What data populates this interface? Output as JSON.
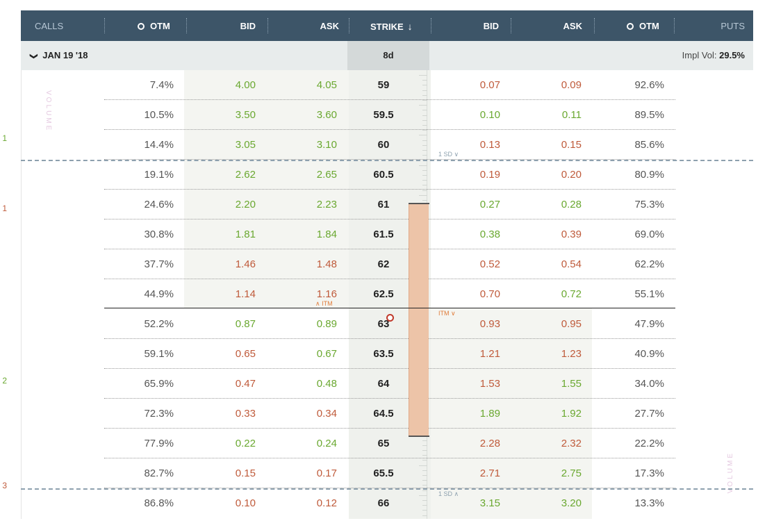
{
  "header": {
    "calls": "CALLS",
    "call_otm": "OTM",
    "call_bid": "BID",
    "call_ask": "ASK",
    "strike": "STRIKE",
    "strike_sort_icon": "↓",
    "put_bid": "BID",
    "put_ask": "ASK",
    "put_otm": "OTM",
    "puts": "PUTS"
  },
  "expiry": {
    "chevron": "❯",
    "label": "JAN 19 '18",
    "days": "8d",
    "impl_vol_label": "Impl Vol: ",
    "impl_vol_value": "29.5%"
  },
  "volume_label": "VOLUME",
  "gutter": [
    {
      "text": "1",
      "color": "#6aa830"
    },
    {
      "text": "1",
      "color": "#bf5a3a"
    },
    {
      "text": "2",
      "color": "#6aa830"
    },
    {
      "text": "3",
      "color": "#bf5a3a"
    }
  ],
  "sd_labels": {
    "upper": "1 SD ∨",
    "lower": "1 SD ∧"
  },
  "itm_labels": {
    "calls": "∧ ITM",
    "puts": "ITM ∨"
  },
  "colors": {
    "green": "#6aa830",
    "red": "#bf5a3a",
    "header_bg": "#3d5568",
    "expected_move": "#edc4a8"
  },
  "rows": [
    {
      "call_otm": "7.4%",
      "call_bid": "4.00",
      "call_bid_c": "green",
      "call_ask": "4.05",
      "call_ask_c": "green",
      "strike": "59",
      "put_bid": "0.07",
      "put_bid_c": "red",
      "put_ask": "0.09",
      "put_ask_c": "red",
      "put_otm": "92.6%"
    },
    {
      "call_otm": "10.5%",
      "call_bid": "3.50",
      "call_bid_c": "green",
      "call_ask": "3.60",
      "call_ask_c": "green",
      "strike": "59.5",
      "put_bid": "0.10",
      "put_bid_c": "green",
      "put_ask": "0.11",
      "put_ask_c": "green",
      "put_otm": "89.5%"
    },
    {
      "call_otm": "14.4%",
      "call_bid": "3.05",
      "call_bid_c": "green",
      "call_ask": "3.10",
      "call_ask_c": "green",
      "strike": "60",
      "put_bid": "0.13",
      "put_bid_c": "red",
      "put_ask": "0.15",
      "put_ask_c": "red",
      "put_otm": "85.6%"
    },
    {
      "call_otm": "19.1%",
      "call_bid": "2.62",
      "call_bid_c": "green",
      "call_ask": "2.65",
      "call_ask_c": "green",
      "strike": "60.5",
      "put_bid": "0.19",
      "put_bid_c": "red",
      "put_ask": "0.20",
      "put_ask_c": "red",
      "put_otm": "80.9%"
    },
    {
      "call_otm": "24.6%",
      "call_bid": "2.20",
      "call_bid_c": "green",
      "call_ask": "2.23",
      "call_ask_c": "green",
      "strike": "61",
      "put_bid": "0.27",
      "put_bid_c": "green",
      "put_ask": "0.28",
      "put_ask_c": "green",
      "put_otm": "75.3%"
    },
    {
      "call_otm": "30.8%",
      "call_bid": "1.81",
      "call_bid_c": "green",
      "call_ask": "1.84",
      "call_ask_c": "green",
      "strike": "61.5",
      "put_bid": "0.38",
      "put_bid_c": "green",
      "put_ask": "0.39",
      "put_ask_c": "red",
      "put_otm": "69.0%"
    },
    {
      "call_otm": "37.7%",
      "call_bid": "1.46",
      "call_bid_c": "red",
      "call_ask": "1.48",
      "call_ask_c": "red",
      "strike": "62",
      "put_bid": "0.52",
      "put_bid_c": "red",
      "put_ask": "0.54",
      "put_ask_c": "red",
      "put_otm": "62.2%"
    },
    {
      "call_otm": "44.9%",
      "call_bid": "1.14",
      "call_bid_c": "red",
      "call_ask": "1.16",
      "call_ask_c": "red",
      "strike": "62.5",
      "put_bid": "0.70",
      "put_bid_c": "red",
      "put_ask": "0.72",
      "put_ask_c": "green",
      "put_otm": "55.1%"
    },
    {
      "call_otm": "52.2%",
      "call_bid": "0.87",
      "call_bid_c": "green",
      "call_ask": "0.89",
      "call_ask_c": "green",
      "strike": "63",
      "put_bid": "0.93",
      "put_bid_c": "red",
      "put_ask": "0.95",
      "put_ask_c": "red",
      "put_otm": "47.9%"
    },
    {
      "call_otm": "59.1%",
      "call_bid": "0.65",
      "call_bid_c": "red",
      "call_ask": "0.67",
      "call_ask_c": "green",
      "strike": "63.5",
      "put_bid": "1.21",
      "put_bid_c": "red",
      "put_ask": "1.23",
      "put_ask_c": "red",
      "put_otm": "40.9%"
    },
    {
      "call_otm": "65.9%",
      "call_bid": "0.47",
      "call_bid_c": "red",
      "call_ask": "0.48",
      "call_ask_c": "green",
      "strike": "64",
      "put_bid": "1.53",
      "put_bid_c": "red",
      "put_ask": "1.55",
      "put_ask_c": "green",
      "put_otm": "34.0%"
    },
    {
      "call_otm": "72.3%",
      "call_bid": "0.33",
      "call_bid_c": "red",
      "call_ask": "0.34",
      "call_ask_c": "red",
      "strike": "64.5",
      "put_bid": "1.89",
      "put_bid_c": "green",
      "put_ask": "1.92",
      "put_ask_c": "green",
      "put_otm": "27.7%"
    },
    {
      "call_otm": "77.9%",
      "call_bid": "0.22",
      "call_bid_c": "green",
      "call_ask": "0.24",
      "call_ask_c": "green",
      "strike": "65",
      "put_bid": "2.28",
      "put_bid_c": "red",
      "put_ask": "2.32",
      "put_ask_c": "red",
      "put_otm": "22.2%"
    },
    {
      "call_otm": "82.7%",
      "call_bid": "0.15",
      "call_bid_c": "red",
      "call_ask": "0.17",
      "call_ask_c": "red",
      "strike": "65.5",
      "put_bid": "2.71",
      "put_bid_c": "red",
      "put_ask": "2.75",
      "put_ask_c": "green",
      "put_otm": "17.3%"
    },
    {
      "call_otm": "86.8%",
      "call_bid": "0.10",
      "call_bid_c": "red",
      "call_ask": "0.12",
      "call_ask_c": "red",
      "strike": "66",
      "put_bid": "3.15",
      "put_bid_c": "green",
      "put_ask": "3.20",
      "put_ask_c": "green",
      "put_otm": "13.3%"
    }
  ]
}
